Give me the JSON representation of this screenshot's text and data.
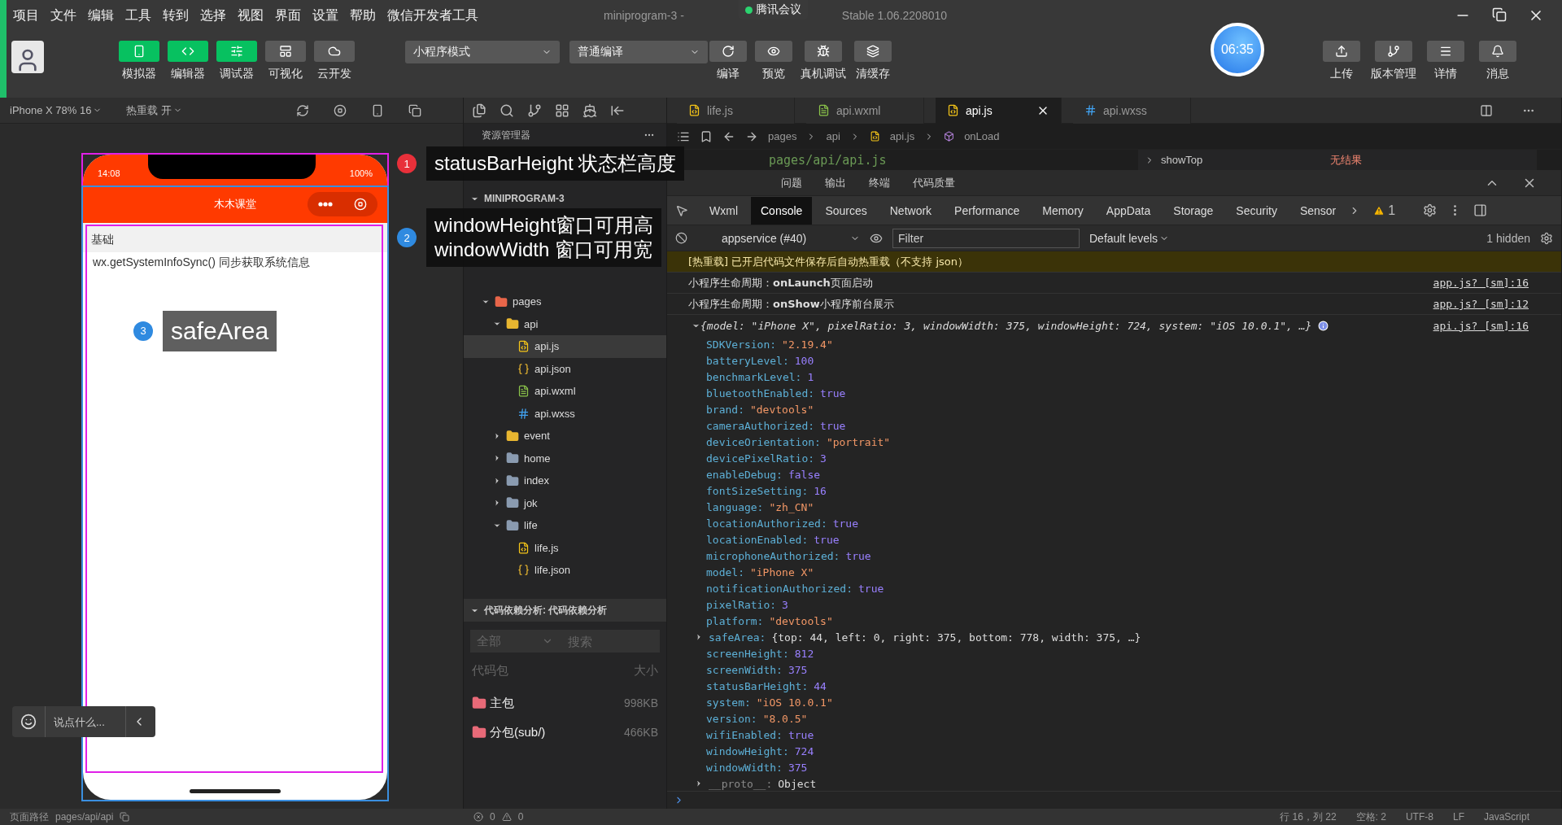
{
  "menu": [
    "项目",
    "文件",
    "编辑",
    "工具",
    "转到",
    "选择",
    "视图",
    "界面",
    "设置",
    "帮助",
    "微信开发者工具"
  ],
  "window_title": {
    "left": "miniprogram-3 -",
    "right": "Stable 1.06.2208010"
  },
  "meeting_badge": "腾讯会议",
  "clock": "06:35",
  "toolbar_left": [
    {
      "label": "模拟器",
      "on": true
    },
    {
      "label": "编辑器",
      "on": true
    },
    {
      "label": "调试器",
      "on": true
    },
    {
      "label": "可视化",
      "on": false
    },
    {
      "label": "云开发",
      "on": false
    }
  ],
  "mode_select": "小程序模式",
  "compile_select": "普通编译",
  "toolbar_mid": [
    {
      "label": "编译"
    },
    {
      "label": "预览"
    },
    {
      "label": "真机调试"
    },
    {
      "label": "清缓存"
    }
  ],
  "toolbar_right": [
    {
      "label": "上传"
    },
    {
      "label": "版本管理"
    },
    {
      "label": "详情"
    },
    {
      "label": "消息"
    }
  ],
  "simulator": {
    "device": "iPhone X 78% 16",
    "hot_reload": "热重载 开",
    "time": "14:08",
    "battery": "100%",
    "nav_title": "木木课堂",
    "section": "基础",
    "text": "wx.getSystemInfoSync() 同步获取系统信息",
    "chat_placeholder": "说点什么..."
  },
  "annotations": [
    {
      "number": "1",
      "color": "#e8303a",
      "lines": [
        "statusBarHeight 状态栏高度"
      ]
    },
    {
      "number": "2",
      "color": "#2f8ae0",
      "lines": [
        "windowHeight窗口可用高",
        "windowWidth 窗口可用宽"
      ]
    },
    {
      "number": "3",
      "color": "#2f8ae0",
      "lines": [
        "safeArea"
      ]
    }
  ],
  "explorer": {
    "title": "资源管理器",
    "project": "MINIPROGRAM-3",
    "tree": [
      {
        "name": "pages",
        "kind": "folder",
        "color": "#e8664a",
        "expanded": true,
        "selected": false,
        "children": [
          {
            "name": "api",
            "kind": "folder",
            "color": "#e8b630",
            "expanded": true,
            "selected": false,
            "children": [
              {
                "name": "api.js",
                "kind": "js",
                "selected": true
              },
              {
                "name": "api.json",
                "kind": "json",
                "selected": false
              },
              {
                "name": "api.wxml",
                "kind": "wxml",
                "selected": false
              },
              {
                "name": "api.wxss",
                "kind": "wxss",
                "selected": false
              }
            ]
          },
          {
            "name": "event",
            "kind": "folder",
            "color": "#e8b630",
            "expanded": false,
            "selected": false
          },
          {
            "name": "home",
            "kind": "folder",
            "color": "#8a9bb0",
            "expanded": false,
            "selected": false
          },
          {
            "name": "index",
            "kind": "folder",
            "color": "#8a9bb0",
            "expanded": false,
            "selected": false
          },
          {
            "name": "jok",
            "kind": "folder",
            "color": "#8a9bb0",
            "expanded": false,
            "selected": false
          },
          {
            "name": "life",
            "kind": "folder",
            "color": "#8a9bb0",
            "expanded": true,
            "selected": false,
            "children": [
              {
                "name": "life.js",
                "kind": "js",
                "selected": false
              },
              {
                "name": "life.json",
                "kind": "json",
                "selected": false
              }
            ]
          }
        ]
      }
    ]
  },
  "dependency": {
    "title": "代码依赖分析: 代码依赖分析",
    "filter": "全部",
    "search_placeholder": "搜索",
    "column_1": "代码包",
    "column_2": "大小",
    "packages": [
      {
        "name": "主包",
        "size": "998KB"
      },
      {
        "name": "分包(sub/)",
        "size": "466KB"
      }
    ]
  },
  "editor_tabs": [
    {
      "label": "life.js",
      "kind": "js",
      "selected": false
    },
    {
      "label": "api.wxml",
      "kind": "wxml",
      "selected": false
    },
    {
      "label": "api.js",
      "kind": "js",
      "selected": true
    },
    {
      "label": "api.wxss",
      "kind": "wxss",
      "selected": false
    }
  ],
  "breadcrumb": [
    "pages",
    "api",
    "api.js",
    "onLoad"
  ],
  "code_line": "pages/api/api.js",
  "find": {
    "value": "showTop",
    "result": "无结果"
  },
  "panel_tabs": [
    "问题",
    "输出",
    "终端",
    "代码质量"
  ],
  "devtools_tabs": [
    {
      "label": "Wxml",
      "selected": false
    },
    {
      "label": "Console",
      "selected": true
    },
    {
      "label": "Sources",
      "selected": false
    },
    {
      "label": "Network",
      "selected": false
    },
    {
      "label": "Performance",
      "selected": false
    },
    {
      "label": "Memory",
      "selected": false
    },
    {
      "label": "AppData",
      "selected": false
    },
    {
      "label": "Storage",
      "selected": false
    },
    {
      "label": "Security",
      "selected": false
    },
    {
      "label": "Sensor",
      "selected": false
    }
  ],
  "warning_count": "1",
  "context": "appservice (#40)",
  "filter_placeholder": "Filter",
  "levels": "Default levels",
  "hidden": "1 hidden",
  "messages": [
    {
      "kind": "warning",
      "text": "[热重载] 已开启代码文件保存后自动热重载（不支持 json）"
    },
    {
      "kind": "log",
      "text": "小程序生命周期：**onLaunch**页面启动",
      "source": "app.js? [sm]:16"
    },
    {
      "kind": "log",
      "text": "小程序生命周期：**onShow**小程序前台展示",
      "source": "app.js? [sm]:12"
    }
  ],
  "object_log": {
    "summary": "{model: \"iPhone X\", pixelRatio: 3, windowWidth: 375, windowHeight: 724, system: \"iOS 10.0.1\", …}",
    "source": "api.js? [sm]:16",
    "expanded": true,
    "properties": [
      {
        "key": "SDKVersion:",
        "value": "\"2.19.4\"",
        "kind": "string"
      },
      {
        "key": "batteryLevel:",
        "value": "100",
        "kind": "number"
      },
      {
        "key": "benchmarkLevel:",
        "value": "1",
        "kind": "number"
      },
      {
        "key": "bluetoothEnabled:",
        "value": "true",
        "kind": "number"
      },
      {
        "key": "brand:",
        "value": "\"devtools\"",
        "kind": "string"
      },
      {
        "key": "cameraAuthorized:",
        "value": "true",
        "kind": "number"
      },
      {
        "key": "deviceOrientation:",
        "value": "\"portrait\"",
        "kind": "string"
      },
      {
        "key": "devicePixelRatio:",
        "value": "3",
        "kind": "number"
      },
      {
        "key": "enableDebug:",
        "value": "false",
        "kind": "number"
      },
      {
        "key": "fontSizeSetting:",
        "value": "16",
        "kind": "number"
      },
      {
        "key": "language:",
        "value": "\"zh_CN\"",
        "kind": "string"
      },
      {
        "key": "locationAuthorized:",
        "value": "true",
        "kind": "number"
      },
      {
        "key": "locationEnabled:",
        "value": "true",
        "kind": "number"
      },
      {
        "key": "microphoneAuthorized:",
        "value": "true",
        "kind": "number"
      },
      {
        "key": "model:",
        "value": "\"iPhone X\"",
        "kind": "string"
      },
      {
        "key": "notificationAuthorized:",
        "value": "true",
        "kind": "number"
      },
      {
        "key": "pixelRatio:",
        "value": "3",
        "kind": "number"
      },
      {
        "key": "platform:",
        "value": "\"devtools\"",
        "kind": "string"
      },
      {
        "key": "safeArea:",
        "value": "{top: 44, left: 0, right: 375, bottom: 778, width: 375, …}",
        "kind": "object",
        "expanded": false
      },
      {
        "key": "screenHeight:",
        "value": "812",
        "kind": "number"
      },
      {
        "key": "screenWidth:",
        "value": "375",
        "kind": "number"
      },
      {
        "key": "statusBarHeight:",
        "value": "44",
        "kind": "number"
      },
      {
        "key": "system:",
        "value": "\"iOS 10.0.1\"",
        "kind": "string"
      },
      {
        "key": "version:",
        "value": "\"8.0.5\"",
        "kind": "string"
      },
      {
        "key": "wifiEnabled:",
        "value": "true",
        "kind": "number"
      },
      {
        "key": "windowHeight:",
        "value": "724",
        "kind": "number"
      },
      {
        "key": "windowWidth:",
        "value": "375",
        "kind": "number"
      },
      {
        "key": "__proto__:",
        "value": "Object",
        "kind": "proto",
        "expanded": false
      }
    ]
  },
  "status_bar": {
    "page_path_label": "页面路径",
    "page_path": "pages/api/api",
    "errors": "0",
    "warnings": "0",
    "items": [
      "行 16，列 22",
      "空格: 2",
      "UTF-8",
      "LF",
      "JavaScript"
    ]
  }
}
